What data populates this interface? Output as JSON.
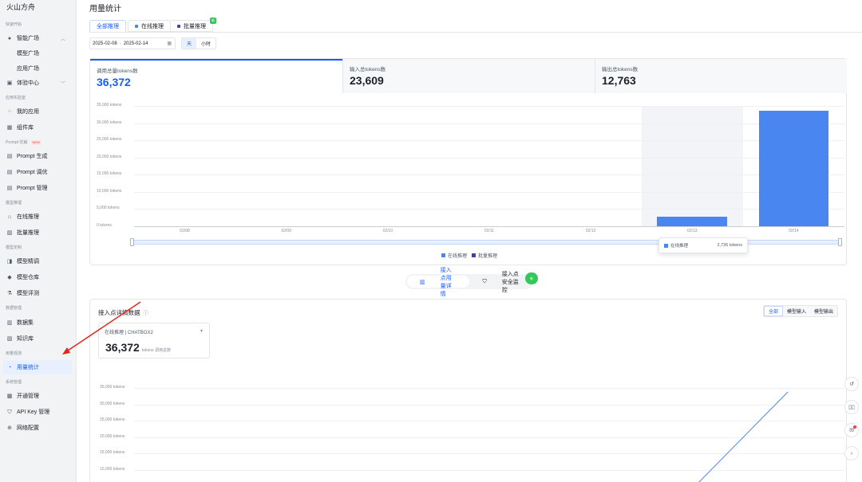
{
  "brand": "火山方舟",
  "sidebar": {
    "sections": {
      "quick": "快速开始",
      "app_lab": "应用实验室",
      "prompt": "Prompt 优解",
      "prompt_badge": "NEW",
      "model_infer": "模型推理",
      "model_custom": "模型定制",
      "data": "数据管理",
      "usage": "用量观测",
      "system": "系统管理"
    },
    "items": {
      "smart_plaza": "智能广场",
      "model_plaza": "模型广场",
      "app_plaza": "应用广场",
      "experience": "体验中心",
      "my_apps": "我的应用",
      "components": "组件库",
      "prompt_gen": "Prompt 生成",
      "prompt_tune": "Prompt 调优",
      "prompt_manage": "Prompt 管理",
      "online_infer": "在线推理",
      "batch_infer": "批量推理",
      "finetune": "模型精调",
      "model_repo": "模型仓库",
      "model_eval": "模型评测",
      "dataset": "数据集",
      "knowledge": "知识库",
      "usage_stats": "用量统计",
      "activation": "开通管理",
      "apikey": "API Key 管理",
      "network": "网络配置"
    }
  },
  "header": {
    "title": "用量统计",
    "tabs": {
      "all": "全部推理",
      "online": "在线推理",
      "batch": "批量推理",
      "new_badge": "新"
    }
  },
  "filters": {
    "date_start": "2025-02-08",
    "date_end": "2025-02-14",
    "date_sep": "-",
    "granularity": {
      "day": "天",
      "hour": "小时"
    }
  },
  "stats": [
    {
      "label": "调用总量tokens数",
      "value": "36,372"
    },
    {
      "label": "输入总tokens数",
      "value": "23,609"
    },
    {
      "label": "输出总tokens数",
      "value": "12,763"
    }
  ],
  "colors": {
    "accent": "#165dff",
    "online": "#4a86f0",
    "batch": "#4b3bb0"
  },
  "chart_data": [
    {
      "type": "bar",
      "categories": [
        "02/08",
        "02/09",
        "02/10",
        "02/11",
        "02/12",
        "02/13",
        "02/14"
      ],
      "series": [
        {
          "name": "在线推理",
          "values": [
            0,
            0,
            0,
            0,
            0,
            2736,
            33636
          ]
        },
        {
          "name": "批量推理",
          "values": [
            0,
            0,
            0,
            0,
            0,
            0,
            0
          ]
        }
      ],
      "ytick_labels": [
        "35,000 tokens",
        "30,000 tokens",
        "25,000 tokens",
        "20,000 tokens",
        "15,000 tokens",
        "10,000 tokens",
        "5,000 tokens",
        "0 tokens"
      ],
      "ylim": [
        0,
        35000
      ],
      "legend": "bottom",
      "tooltip": {
        "category": "02/13",
        "series": "在线推理",
        "value": "2,736 tokens"
      }
    },
    {
      "type": "line",
      "ytick_labels": [
        "35,000 tokens",
        "30,000 tokens",
        "25,000 tokens",
        "20,000 tokens",
        "15,000 tokens",
        "10,000 tokens"
      ],
      "ylim": [
        10000,
        35000
      ]
    }
  ],
  "bottom_toggle": {
    "usage_detail": "接入点用量详情",
    "security": "接入点安全监控",
    "new_badge": "新"
  },
  "detail": {
    "title": "接入点详情数据",
    "endpoint_select": "在线推理 | CHATBOX2",
    "total": "36,372",
    "total_unit": "tokens 调用总数",
    "filter_tabs": [
      "全部",
      "模型输入",
      "模型输出"
    ]
  }
}
